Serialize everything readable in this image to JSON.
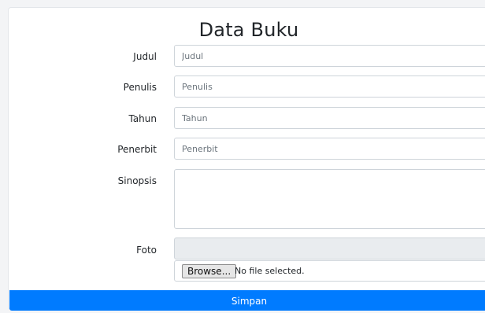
{
  "form": {
    "title": "Data Buku",
    "fields": [
      {
        "label": "Judul",
        "placeholder": "Judul",
        "value": ""
      },
      {
        "label": "Penulis",
        "placeholder": "Penulis",
        "value": ""
      },
      {
        "label": "Tahun",
        "placeholder": "Tahun",
        "value": ""
      },
      {
        "label": "Penerbit",
        "placeholder": "Penerbit",
        "value": ""
      }
    ],
    "sinopsis": {
      "label": "Sinopsis",
      "value": ""
    },
    "foto": {
      "label": "Foto",
      "browse_label": "Browse...",
      "status": "No file selected."
    },
    "submit_label": "Simpan"
  },
  "colors": {
    "primary": "#007bff",
    "disabled_bg": "#e9ecef",
    "border": "#ced4da"
  }
}
